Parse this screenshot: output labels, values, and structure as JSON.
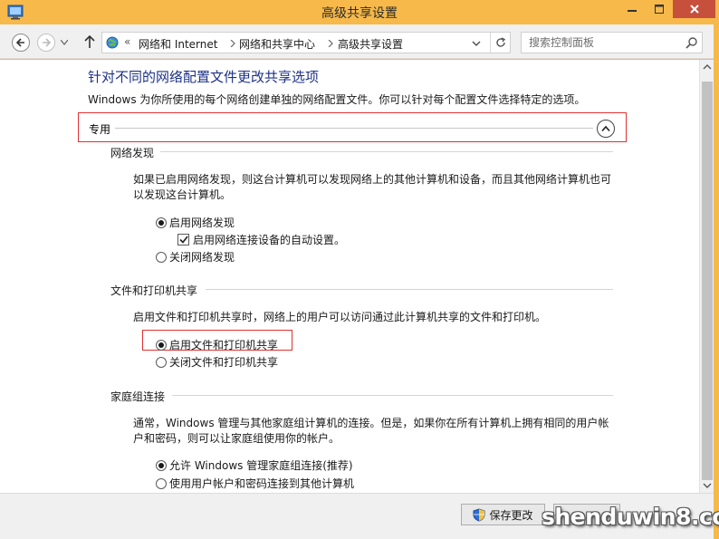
{
  "window": {
    "title": "高级共享设置"
  },
  "address": {
    "overflow": "«",
    "crumbs": [
      "网络和 Internet",
      "网络和共享中心",
      "高级共享设置"
    ]
  },
  "search": {
    "placeholder": "搜索控制面板"
  },
  "page": {
    "title": "针对不同的网络配置文件更改共享选项",
    "description": "Windows 为你所使用的每个网络创建单独的网络配置文件。你可以针对每个配置文件选择特定的选项。"
  },
  "profile": {
    "label": "专用"
  },
  "network_discovery": {
    "heading": "网络发现",
    "description": "如果已启用网络发现，则这台计算机可以发现网络上的其他计算机和设备，而且其他网络计算机也可以发现这台计算机。",
    "options": [
      {
        "label": "启用网络发现",
        "selected": true
      },
      {
        "label": "关闭网络发现",
        "selected": false
      }
    ],
    "auto_setup": {
      "label": "启用网络连接设备的自动设置。",
      "checked": true
    }
  },
  "file_printer_sharing": {
    "heading": "文件和打印机共享",
    "description": "启用文件和打印机共享时，网络上的用户可以访问通过此计算机共享的文件和打印机。",
    "options": [
      {
        "label": "启用文件和打印机共享",
        "selected": true
      },
      {
        "label": "关闭文件和打印机共享",
        "selected": false
      }
    ]
  },
  "homegroup": {
    "heading": "家庭组连接",
    "description": "通常，Windows 管理与其他家庭组计算机的连接。但是，如果你在所有计算机上拥有相同的用户帐户和密码，则可以让家庭组使用你的帐户。",
    "options": [
      {
        "label": "允许 Windows 管理家庭组连接(推荐)",
        "selected": true
      },
      {
        "label": "使用用户帐户和密码连接到其他计算机",
        "selected": false
      }
    ]
  },
  "footer": {
    "save_label": "保存更改"
  },
  "watermark": "shenduwin8.com",
  "colors": {
    "titlebar": "#f6b94a",
    "close_button": "#c7503d",
    "heading_blue": "#1e3287",
    "highlight_red": "#e03030"
  }
}
